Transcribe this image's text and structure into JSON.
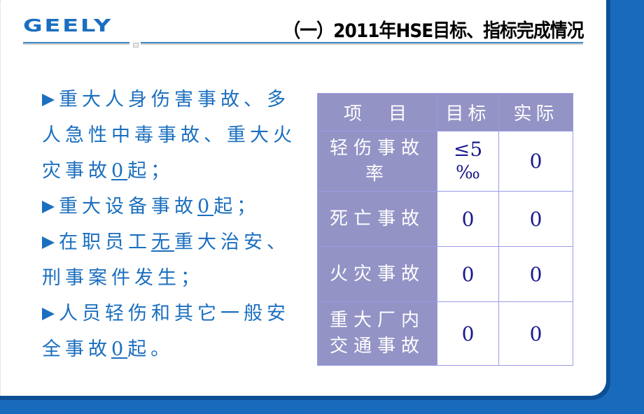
{
  "header": {
    "logo": "GEELY",
    "title": "（一）2011年HSE目标、指标完成情况"
  },
  "colors": {
    "brand_blue": "#1a6ec0",
    "frame_blue": "#1b6fc2",
    "table_header": "#9393c6",
    "value_text": "#1a1a8c"
  },
  "bullets": [
    {
      "icon": "arrow-bullet-icon",
      "lines": [
        [
          {
            "t": "重大人身伤害事故、多"
          }
        ],
        [
          {
            "t": "人急性中毒事故、重大火"
          }
        ],
        [
          {
            "t": "灾事故"
          },
          {
            "t": "0",
            "u": true
          },
          {
            "t": "起；"
          }
        ]
      ]
    },
    {
      "icon": "arrow-bullet-icon",
      "lines": [
        [
          {
            "t": "重大设备事故"
          },
          {
            "t": "0",
            "u": true
          },
          {
            "t": "起；"
          }
        ]
      ]
    },
    {
      "icon": "arrow-bullet-icon",
      "lines": [
        [
          {
            "t": "在职员工"
          },
          {
            "t": "无",
            "u": true
          },
          {
            "t": "重大治安、"
          }
        ],
        [
          {
            "t": "刑事案件发生；"
          }
        ]
      ]
    },
    {
      "icon": "arrow-bullet-icon",
      "lines": [
        [
          {
            "t": "人员轻伤和其它一般安"
          }
        ],
        [
          {
            "t": "全事故"
          },
          {
            "t": "0",
            "u": true
          },
          {
            "t": "起。"
          }
        ]
      ]
    }
  ],
  "table": {
    "headers": [
      "项　目",
      "目标",
      "实际"
    ],
    "rows": [
      {
        "item_lines": [
          "轻伤事故",
          "率"
        ],
        "target_lines": [
          "≤5",
          "‰"
        ],
        "actual": "0"
      },
      {
        "item_lines": [
          "死亡事故"
        ],
        "target_lines": [
          "0"
        ],
        "actual": "0"
      },
      {
        "item_lines": [
          "火灾事故"
        ],
        "target_lines": [
          "0"
        ],
        "actual": "0"
      },
      {
        "item_lines": [
          "重大厂内",
          "交通事故"
        ],
        "target_lines": [
          "0"
        ],
        "actual": "0"
      }
    ]
  }
}
